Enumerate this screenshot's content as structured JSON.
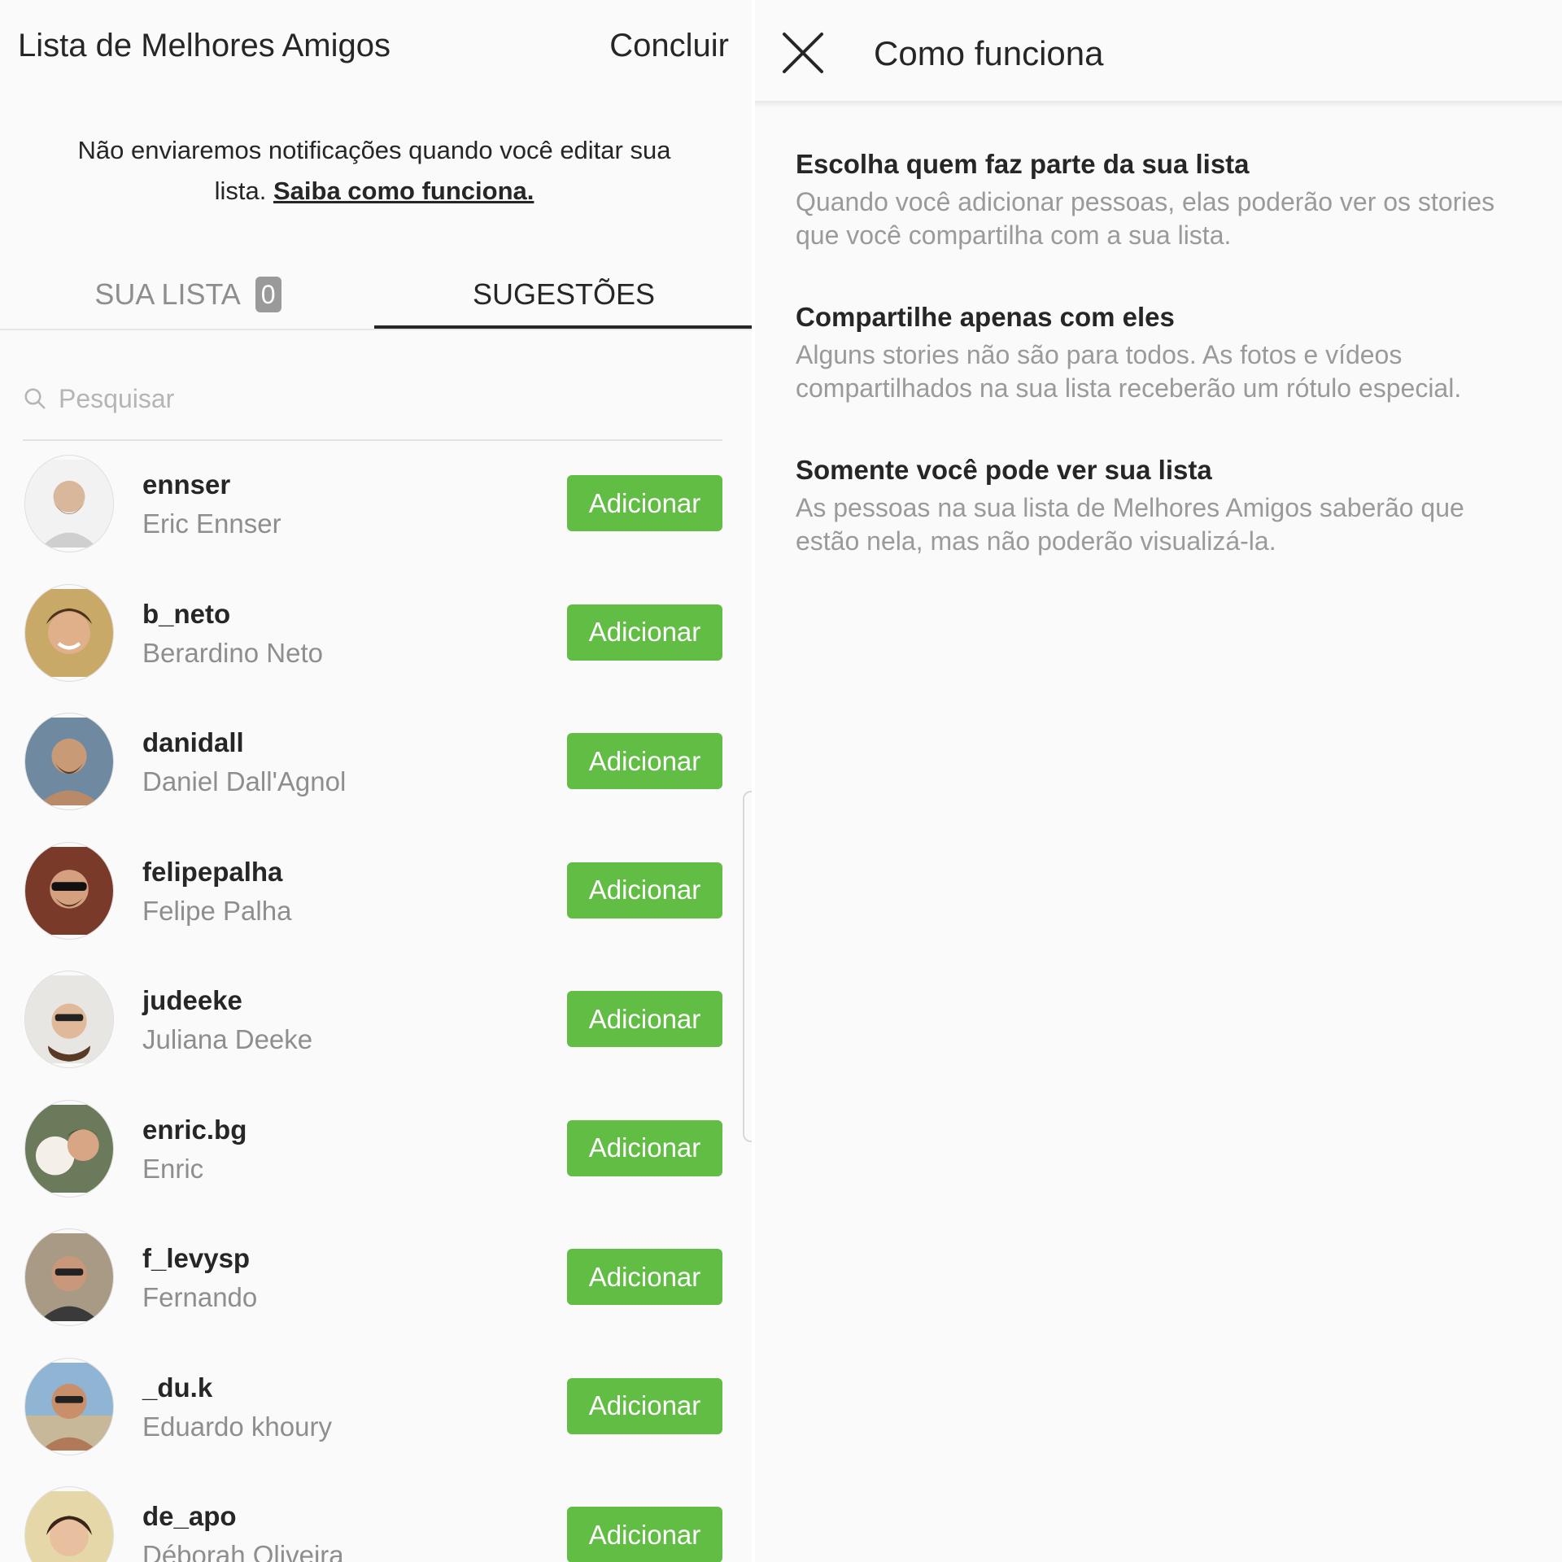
{
  "left": {
    "title": "Lista de Melhores Amigos",
    "done_label": "Concluir",
    "info_text": "Não enviaremos notificações quando você editar sua lista.",
    "info_link": "Saiba como funciona.",
    "tabs": [
      {
        "label": "SUA LISTA",
        "badge": "0"
      },
      {
        "label": "SUGESTÕES"
      }
    ],
    "search": {
      "placeholder": "Pesquisar"
    },
    "add_label": "Adicionar",
    "users": [
      {
        "username": "ennser",
        "name": "Eric Ennser"
      },
      {
        "username": "b_neto",
        "name": "Berardino Neto"
      },
      {
        "username": "danidall",
        "name": "Daniel Dall'Agnol"
      },
      {
        "username": "felipepalha",
        "name": "Felipe Palha"
      },
      {
        "username": "judeeke",
        "name": "Juliana Deeke"
      },
      {
        "username": "enric.bg",
        "name": "Enric"
      },
      {
        "username": "f_levysp",
        "name": "Fernando"
      },
      {
        "username": "_du.k",
        "name": "Eduardo khoury"
      },
      {
        "username": "de_apo",
        "name": "Déborah Oliveira"
      }
    ]
  },
  "right": {
    "title": "Como funciona",
    "sections": [
      {
        "title": "Escolha quem faz parte da sua lista",
        "body": "Quando você adicionar pessoas, elas poderão ver os stories que você compartilha com a sua lista."
      },
      {
        "title": "Compartilhe apenas com eles",
        "body": "Alguns stories não são para todos. As fotos e vídeos compartilhados na sua lista receberão um rótulo especial."
      },
      {
        "title": "Somente você pode ver sua lista",
        "body": "As pessoas na sua lista de Melhores Amigos saberão que estão nela, mas não poderão visualizá-la."
      }
    ]
  },
  "colors": {
    "accent_green": "#62bd45",
    "text": "#262626",
    "muted": "#8e8e8e"
  }
}
